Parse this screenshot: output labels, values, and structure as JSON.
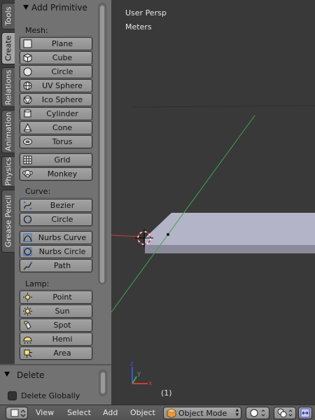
{
  "tabs": [
    "Tools",
    "Create",
    "Relations",
    "Animation",
    "Physics",
    "Grease Pencil"
  ],
  "active_tab": "Create",
  "shelf": {
    "panel_title": "Add Primitive",
    "mesh_label": "Mesh:",
    "mesh": [
      {
        "label": "Plane",
        "icon": "plane-icon"
      },
      {
        "label": "Cube",
        "icon": "cube-icon"
      },
      {
        "label": "Circle",
        "icon": "circle-icon"
      },
      {
        "label": "UV Sphere",
        "icon": "uv-sphere-icon"
      },
      {
        "label": "Ico Sphere",
        "icon": "ico-sphere-icon"
      },
      {
        "label": "Cylinder",
        "icon": "cylinder-icon"
      },
      {
        "label": "Cone",
        "icon": "cone-icon"
      },
      {
        "label": "Torus",
        "icon": "torus-icon"
      }
    ],
    "mesh_extra": [
      {
        "label": "Grid",
        "icon": "grid-icon"
      },
      {
        "label": "Monkey",
        "icon": "monkey-icon"
      }
    ],
    "curve_label": "Curve:",
    "curve": [
      {
        "label": "Bezier",
        "icon": "bezier-icon"
      },
      {
        "label": "Circle",
        "icon": "curve-circle-icon"
      }
    ],
    "curve_extra": [
      {
        "label": "Nurbs Curve",
        "icon": "nurbs-curve-icon"
      },
      {
        "label": "Nurbs Circle",
        "icon": "nurbs-circle-icon"
      },
      {
        "label": "Path",
        "icon": "path-icon"
      }
    ],
    "lamp_label": "Lamp:",
    "lamp": [
      {
        "label": "Point",
        "icon": "point-lamp-icon"
      },
      {
        "label": "Sun",
        "icon": "sun-lamp-icon"
      },
      {
        "label": "Spot",
        "icon": "spot-lamp-icon"
      },
      {
        "label": "Hemi",
        "icon": "hemi-lamp-icon"
      },
      {
        "label": "Area",
        "icon": "area-lamp-icon"
      }
    ]
  },
  "delete_panel": {
    "title": "Delete",
    "option_label": "Delete Globally",
    "option_checked": false
  },
  "viewport": {
    "view_name": "User Persp",
    "units": "Meters",
    "frame": "(1)"
  },
  "header": {
    "menus": [
      "View",
      "Select",
      "Add",
      "Object"
    ],
    "mode": "Object Mode"
  },
  "colors": {
    "accent_x": "#c8403a",
    "accent_y": "#3ea64b",
    "accent_z": "#3a56d0",
    "mesh_face": "#b4b4c8"
  }
}
